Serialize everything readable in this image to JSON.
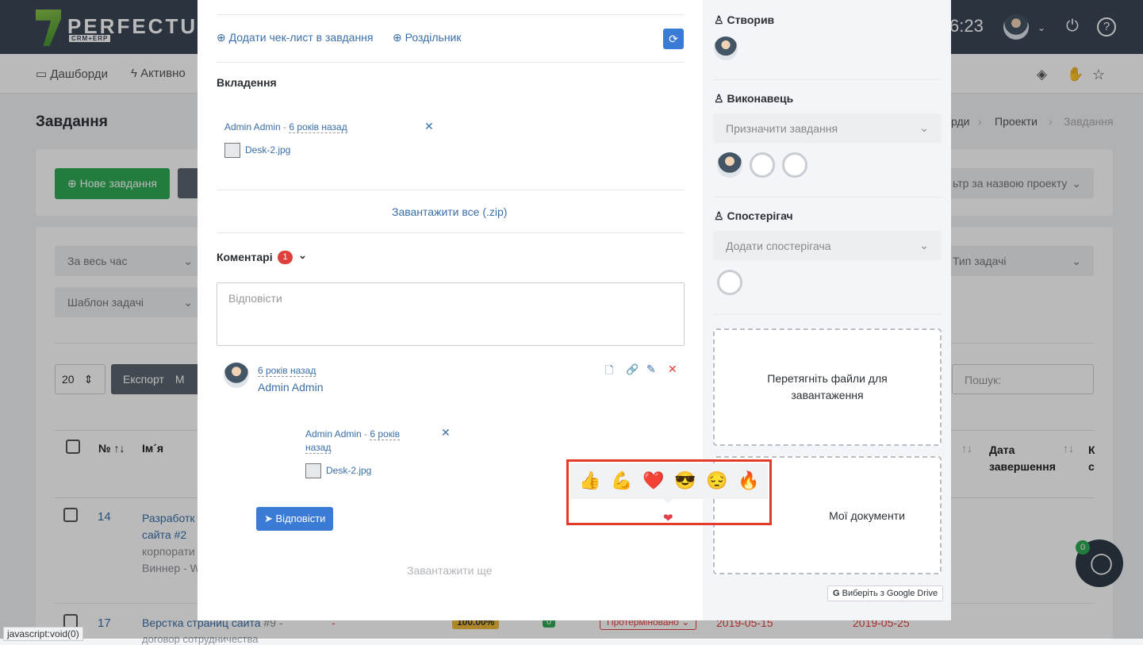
{
  "app": {
    "logo_text": "PERFECTUM",
    "logo_sub": "CRM+ERP",
    "clock": "6:23",
    "menu": [
      "Дашборди",
      "Активно"
    ],
    "page_title": "Завдання",
    "breadcrumb": [
      "рди",
      "Проекти",
      "Завдання"
    ],
    "new_task_label": "Нове завдання",
    "project_filter": "ьтр за назвою проекту",
    "filter_period": "За весь час",
    "filter_template": "Шаблон задачі",
    "filter_type": "Тип задачі",
    "page_size": "20",
    "export_label": "Експорт",
    "export_more": "М",
    "search_placeholder": "Пошук:",
    "table_headers": {
      "number": "№",
      "name": "Ім´я",
      "end_date_1": "Дата",
      "end_date_2": "завершення",
      "extra_1": "К",
      "extra_2": "с"
    },
    "rows": [
      {
        "id": "14",
        "name_lines": [
          "Разработк",
          "сайта  #2",
          "корпорати",
          "Виннер - W"
        ]
      },
      {
        "id": "17",
        "name": "Верстка страниц сайта",
        "suffix": "#9 -",
        "dash": "-",
        "progress": "100.00%",
        "count": "0",
        "status": "Протерміновано",
        "start": "2019-05-15",
        "end": "2019-05-25",
        "line2": "договор сотрудничества"
      }
    ],
    "chat_badge": "0",
    "status_bar": "javascript:void(0)"
  },
  "modal": {
    "add_checklist": "Додати чек-лист в завдання",
    "separator": "Роздільник",
    "attachments_title": "Вкладення",
    "attachment": {
      "author": "Admin Admin",
      "sep": " - ",
      "time": "6 років назад",
      "file": "Desk-2.jpg"
    },
    "download_all": "Завантажити все (.zip)",
    "comments_title": "Коментарі",
    "comments_count": "1",
    "reply_placeholder": "Відповісти",
    "comment": {
      "time": "6 років назад",
      "author": "Admin Admin"
    },
    "comment_attachment": {
      "author": "Admin Admin",
      "sep": " - ",
      "time_1": "6 років",
      "time_2": "назад",
      "file": "Desk-2.jpg"
    },
    "reply_button": "Відповісти",
    "load_more": "Завантажити ще",
    "reactions": [
      "👍",
      "💪",
      "❤️",
      "😎",
      "😔",
      "🔥"
    ],
    "selected_reaction": "❤"
  },
  "side": {
    "creator_title": "Створив",
    "assignee_title": "Виконавець",
    "assign_placeholder": "Призначити завдання",
    "watcher_title": "Спостерігач",
    "watcher_placeholder": "Додати спостерігача",
    "dropzone": "Перетягніть файли для завантаження",
    "my_documents": "Мої документи",
    "google_drive": "Виберіть з Google Drive"
  },
  "colors": {
    "highlight": "#e53b2c",
    "accent": "#3a7bd5",
    "success": "#2eaa55",
    "danger": "#e0403c"
  }
}
